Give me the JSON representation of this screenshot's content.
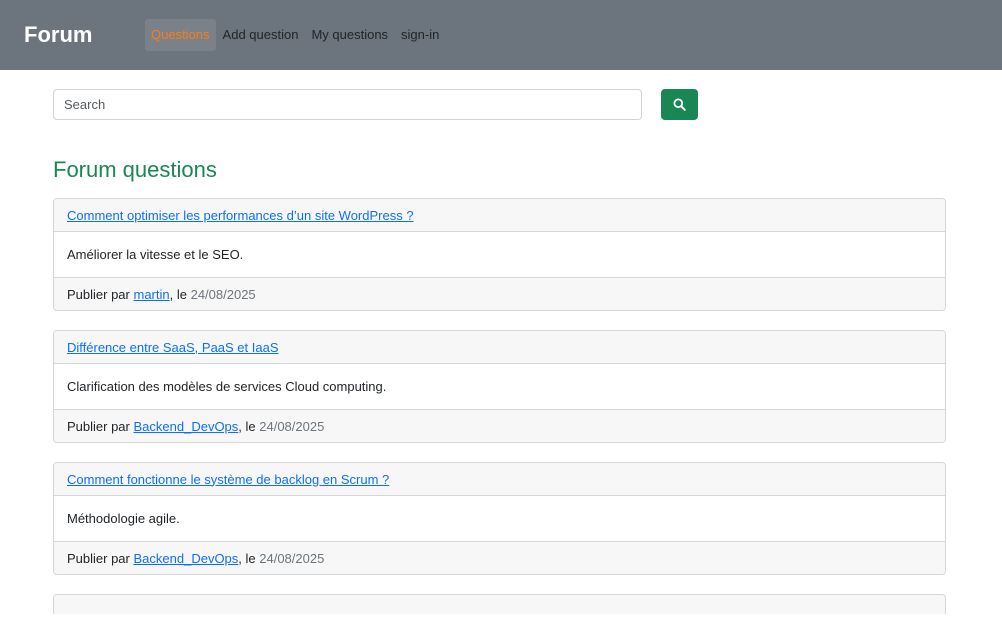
{
  "navbar": {
    "brand": "Forum",
    "items": [
      {
        "label": "Questions",
        "active": true
      },
      {
        "label": "Add question",
        "active": false
      },
      {
        "label": "My questions",
        "active": false
      },
      {
        "label": "sign-in",
        "active": false
      }
    ]
  },
  "search": {
    "placeholder": "Search",
    "button_icon": "search-icon"
  },
  "page_title": "Forum questions",
  "questions": [
    {
      "title": "Comment optimiser les performances d’un site WordPress ?",
      "description": "Améliorer la vitesse et le SEO.",
      "by_prefix": "Publier par",
      "author": "martin",
      "date_prefix": ", le",
      "date": "24/08/2025"
    },
    {
      "title": "Différence entre SaaS, PaaS et IaaS",
      "description": "Clarification des modèles de services Cloud computing.",
      "by_prefix": "Publier par",
      "author": "Backend_DevOps",
      "date_prefix": ", le",
      "date": "24/08/2025"
    },
    {
      "title": "Comment fonctionne le système de backlog en Scrum ?",
      "description": "Méthodologie agile.",
      "by_prefix": "Publier par",
      "author": "Backend_DevOps",
      "date_prefix": ", le",
      "date": "24/08/2025"
    }
  ],
  "colors": {
    "navbar_bg": "#6c757d",
    "active_link": "#fd7e14",
    "accent_green": "#198754",
    "link_blue": "#0d6efd"
  }
}
